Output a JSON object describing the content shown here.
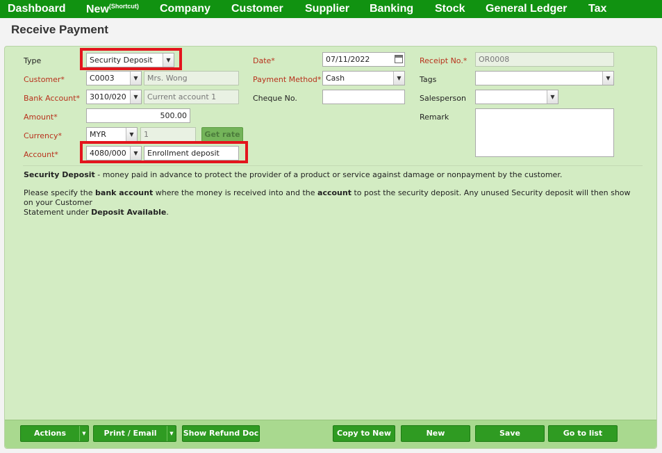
{
  "nav": {
    "items": [
      "Dashboard",
      "New",
      "Company",
      "Customer",
      "Supplier",
      "Banking",
      "Stock",
      "General Ledger",
      "Tax"
    ],
    "new_sup": "(Shortcut)"
  },
  "page": {
    "title": "Receive Payment"
  },
  "form": {
    "type_label": "Type",
    "type_value": "Security Deposit",
    "customer_label": "Customer*",
    "customer_code": "C0003",
    "customer_name": "Mrs. Wong",
    "bank_account_label": "Bank Account*",
    "bank_account_code": "3010/020",
    "bank_account_name": "Current account 1",
    "amount_label": "Amount*",
    "amount_value": "500.00",
    "currency_label": "Currency*",
    "currency_value": "MYR",
    "currency_rate": "1",
    "get_rate_label": "Get rate",
    "account_label": "Account*",
    "account_code": "4080/000",
    "account_name": "Enrollment deposit",
    "date_label": "Date*",
    "date_value": "07/11/2022",
    "payment_method_label": "Payment Method*",
    "payment_method_value": "Cash",
    "cheque_label": "Cheque No.",
    "cheque_value": "",
    "receipt_label": "Receipt No.*",
    "receipt_value": "OR0008",
    "tags_label": "Tags",
    "tags_value": "",
    "salesperson_label": "Salesperson",
    "salesperson_value": "",
    "remark_label": "Remark",
    "remark_value": ""
  },
  "info": {
    "line1_bold": "Security Deposit",
    "line1_rest": " - money paid in advance to protect the provider of a product or service against damage or nonpayment by the customer.",
    "line2_a": "Please specify the ",
    "line2_b": "bank account",
    "line2_c": " where the money is received into and the ",
    "line2_d": "account",
    "line2_e": " to post the security deposit. Any unused Security deposit will then show on your Customer",
    "line3_a": "Statement under ",
    "line3_b": "Deposit Available",
    "line3_c": "."
  },
  "footer": {
    "actions": "Actions",
    "print_email": "Print / Email",
    "show_refund": "Show Refund Doc",
    "copy_to_new": "Copy to New",
    "new": "New",
    "save": "Save",
    "go_to_list": "Go to list"
  },
  "colors": {
    "nav_bg": "#119211",
    "panel_bg": "#d3ecc3",
    "required_label": "#b8311c",
    "button_bg": "#2f9b22",
    "highlight_box": "#e3151d"
  }
}
